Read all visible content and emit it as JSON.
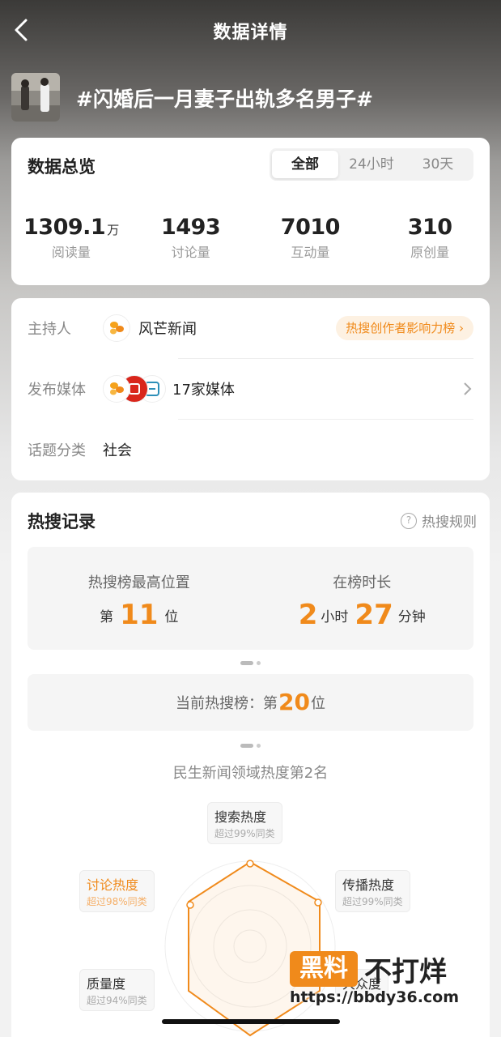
{
  "nav": {
    "title": "数据详情"
  },
  "topic": {
    "title": "#闪婚后一月妻子出轨多名男子#"
  },
  "overview": {
    "title": "数据总览",
    "tabs": [
      "全部",
      "24小时",
      "30天"
    ],
    "active_tab": "全部",
    "stats": [
      {
        "value": "1309.1",
        "unit": "万",
        "label": "阅读量"
      },
      {
        "value": "1493",
        "unit": "",
        "label": "讨论量"
      },
      {
        "value": "7010",
        "unit": "",
        "label": "互动量"
      },
      {
        "value": "310",
        "unit": "",
        "label": "原创量"
      }
    ]
  },
  "info": {
    "host_label": "主持人",
    "host_name": "风芒新闻",
    "host_badge": "热搜创作者影响力榜 ›",
    "media_label": "发布媒体",
    "media_text": "17家媒体",
    "category_label": "话题分类",
    "category_value": "社会"
  },
  "hot": {
    "title": "热搜记录",
    "rules": "热搜规则",
    "peak_label": "热搜榜最高位置",
    "peak_prefix": "第",
    "peak_value": "11",
    "peak_suffix": "位",
    "duration_label": "在榜时长",
    "duration_hours": "2",
    "hours_unit": "小时",
    "duration_minutes": "27",
    "minutes_unit": "分钟",
    "current_prefix": "当前热搜榜：第",
    "current_value": "20",
    "current_suffix": "位",
    "radar_caption": "民生新闻领域热度第2名",
    "radar": [
      {
        "title": "搜索热度",
        "sub": "超过99%同类"
      },
      {
        "title": "传播热度",
        "sub": "超过99%同类"
      },
      {
        "title": "大众度",
        "sub": ""
      },
      {
        "title": "质量度",
        "sub": "超过94%同类"
      },
      {
        "title": "讨论热度",
        "sub": "超过98%同类"
      }
    ]
  },
  "watermark": {
    "brand_box": "黑料",
    "brand_text": "不打烊",
    "url": "https://bbdy36.com"
  },
  "colors": {
    "accent": "#f08a1b",
    "pill_bg": "#fdf1e2"
  }
}
